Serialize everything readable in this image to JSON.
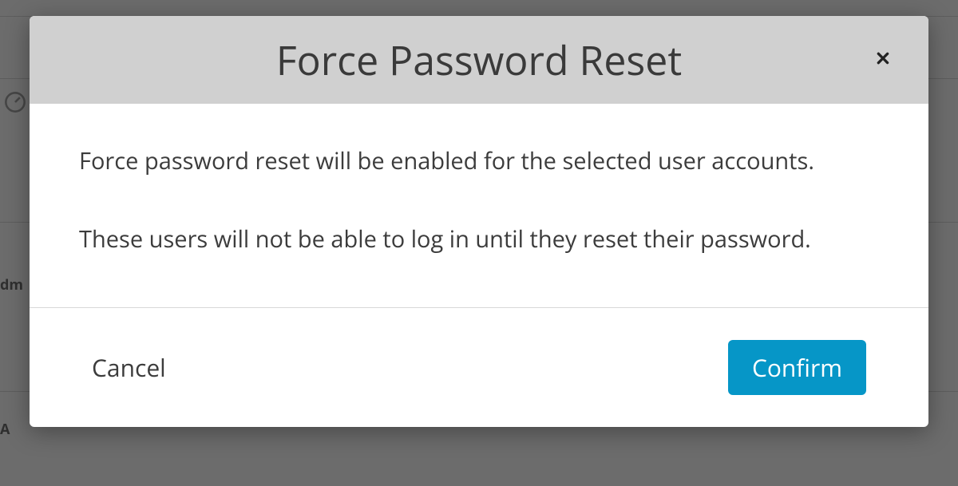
{
  "modal": {
    "title": "Force Password Reset",
    "body": {
      "line1": "Force password reset will be enabled for the selected user accounts.",
      "line2": "These users will not be able to log in until they reset their password."
    },
    "footer": {
      "cancel_label": "Cancel",
      "confirm_label": "Confirm"
    }
  },
  "backdrop": {
    "partial_text_1": "dm",
    "partial_text_2": "A"
  },
  "colors": {
    "confirm_button": "#0696c7",
    "header_bg": "#d0d0d0"
  }
}
